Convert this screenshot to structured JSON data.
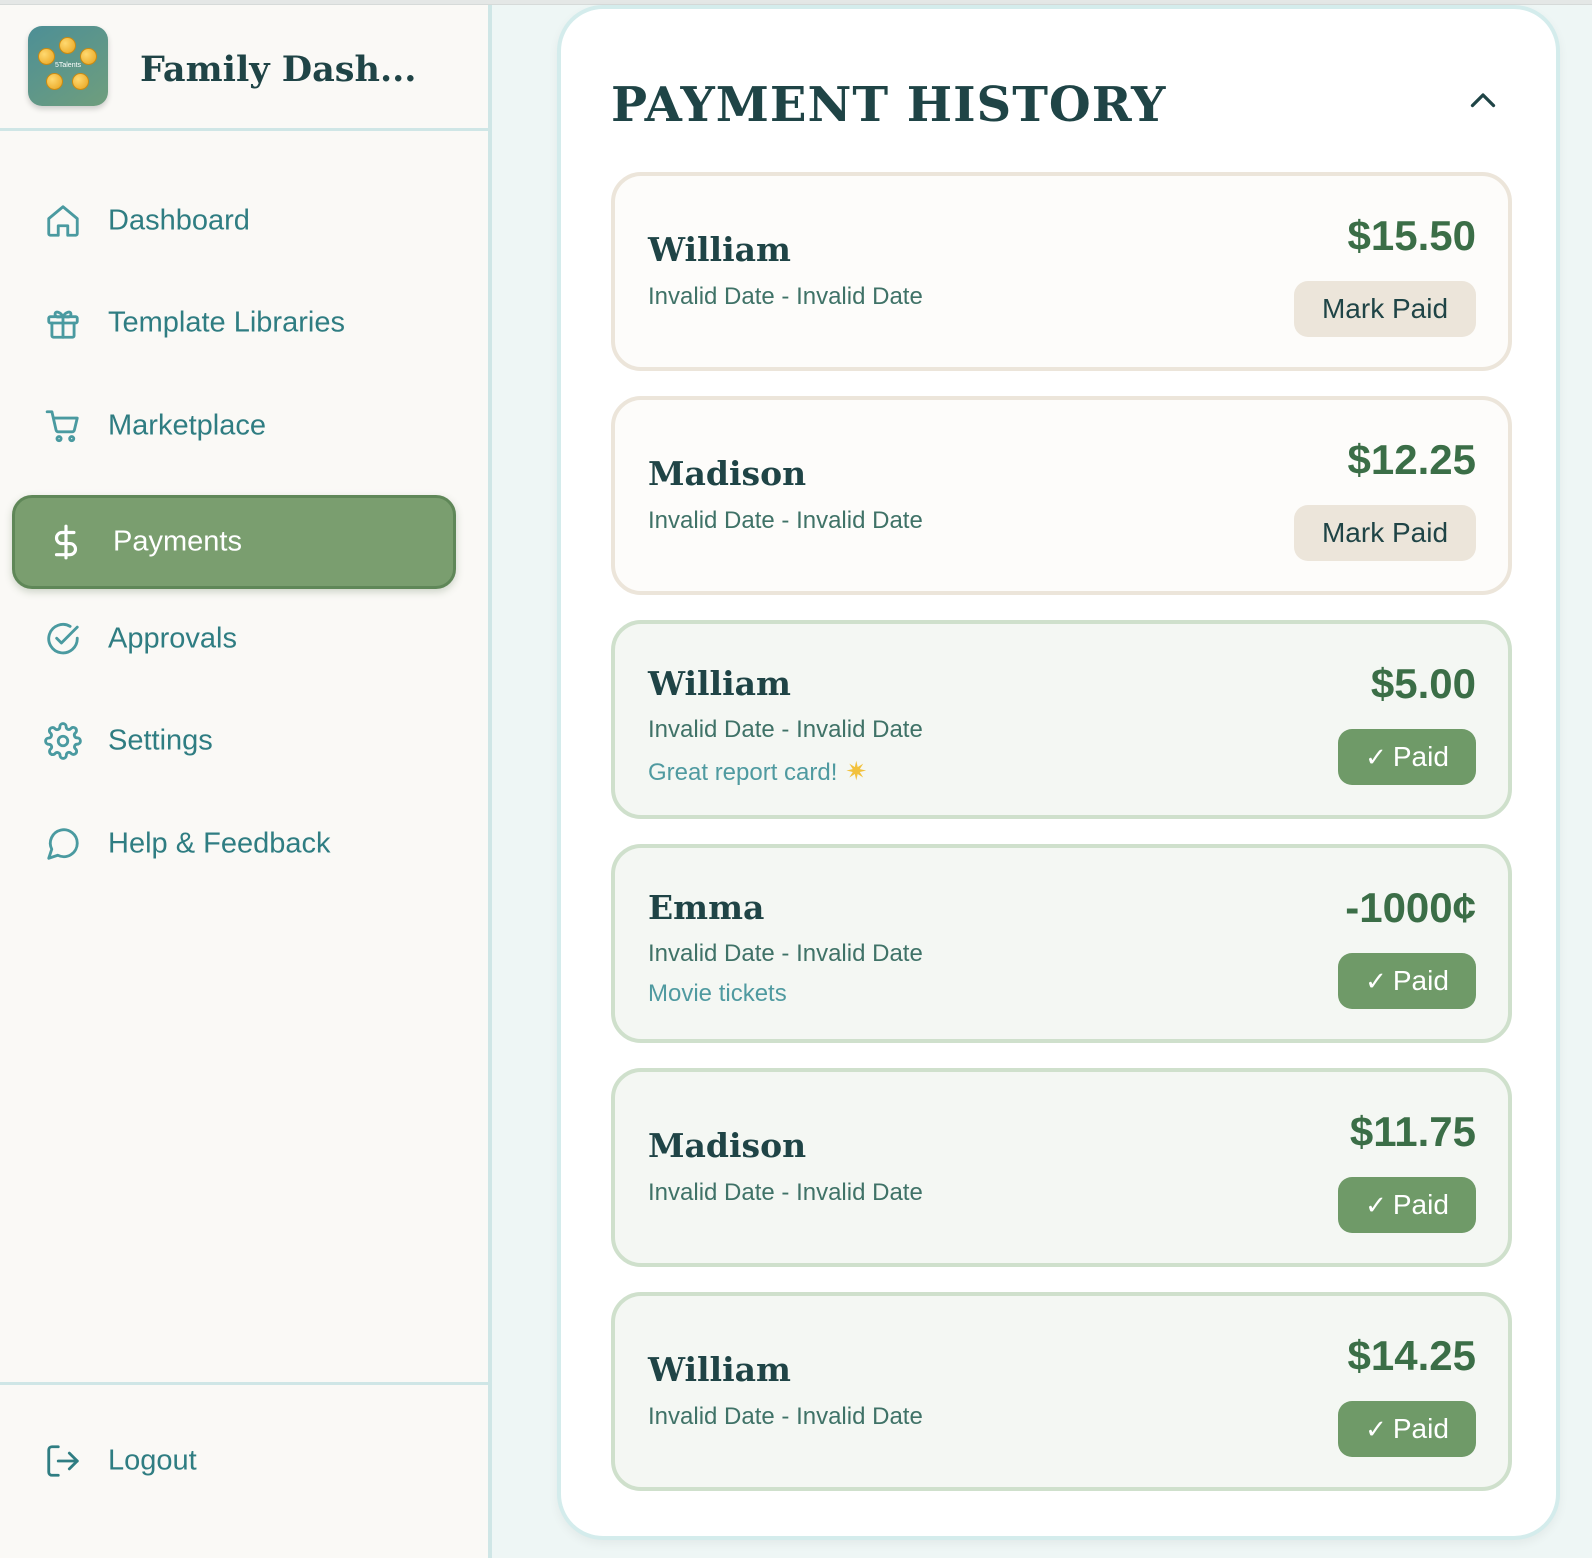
{
  "sidebar": {
    "brand_title": "Family Dash...",
    "logo_text": "5Talents",
    "items": [
      {
        "label": "Dashboard",
        "icon": "home-icon"
      },
      {
        "label": "Template Libraries",
        "icon": "gift-icon"
      },
      {
        "label": "Marketplace",
        "icon": "cart-icon"
      },
      {
        "label": "Payments",
        "icon": "dollar-icon",
        "active": true
      },
      {
        "label": "Approvals",
        "icon": "check-circle-icon"
      },
      {
        "label": "Settings",
        "icon": "gear-icon"
      },
      {
        "label": "Help & Feedback",
        "icon": "chat-bubble-icon"
      }
    ],
    "logout_label": "Logout",
    "logout_icon": "logout-icon"
  },
  "main": {
    "title": "PAYMENT HISTORY",
    "collapse_icon": "chevron-up-icon",
    "payments": [
      {
        "name": "William",
        "dates": "Invalid Date - Invalid Date",
        "note": "",
        "amount": "$15.50",
        "status": "unpaid",
        "action": "Mark Paid"
      },
      {
        "name": "Madison",
        "dates": "Invalid Date - Invalid Date",
        "note": "",
        "amount": "$12.25",
        "status": "unpaid",
        "action": "Mark Paid"
      },
      {
        "name": "William",
        "dates": "Invalid Date - Invalid Date",
        "note": "Great report card!",
        "note_icon": "sparkle-star-icon",
        "amount": "$5.00",
        "status": "paid",
        "action": "Paid"
      },
      {
        "name": "Emma",
        "dates": "Invalid Date - Invalid Date",
        "note": "Movie tickets",
        "amount": "-1000¢",
        "status": "paid",
        "action": "Paid"
      },
      {
        "name": "Madison",
        "dates": "Invalid Date - Invalid Date",
        "note": "",
        "amount": "$11.75",
        "status": "paid",
        "action": "Paid"
      },
      {
        "name": "William",
        "dates": "Invalid Date - Invalid Date",
        "note": "",
        "amount": "$14.25",
        "status": "paid",
        "action": "Paid"
      }
    ]
  },
  "colors": {
    "accent_green": "#7a9e6f",
    "paid_button": "#6f9a68",
    "mark_paid_button": "#ece5da",
    "nav_text": "#2f7d82",
    "heading": "#1f4446",
    "amount": "#3b6e47"
  }
}
